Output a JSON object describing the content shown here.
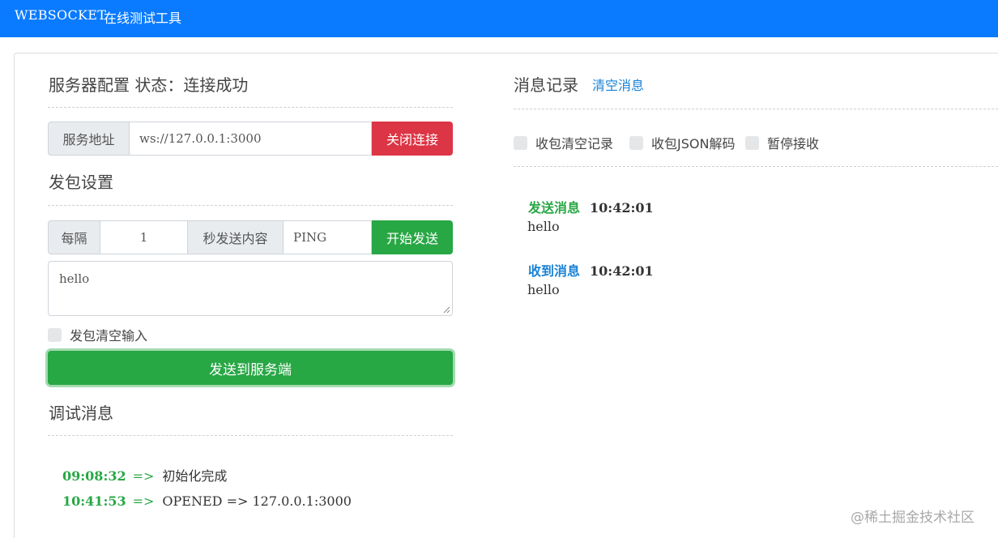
{
  "app": {
    "brand": "WEBSOCKET",
    "subtitle": "在线测试工具"
  },
  "server": {
    "title": "服务器配置 状态：连接成功",
    "address_label": "服务地址",
    "address_value": "ws://127.0.0.1:3000",
    "close_button": "关闭连接"
  },
  "packet": {
    "title": "发包设置",
    "interval_label": "每隔",
    "interval_value": "1",
    "content_label": "秒发送内容",
    "content_value": "PING",
    "start_button": "开始发送",
    "message_text": "hello",
    "clear_input_label": "发包清空输入",
    "send_button": "发送到服务端"
  },
  "debug": {
    "title": "调试消息",
    "entries": [
      {
        "time": "09:08:32",
        "arrow": "=>",
        "text": "初始化完成"
      },
      {
        "time": "10:41:53",
        "arrow": "=>",
        "text": "OPENED => 127.0.0.1:3000"
      }
    ]
  },
  "messages": {
    "title": "消息记录",
    "clear_link": "清空消息",
    "options": [
      "收包清空记录",
      "收包JSON解码",
      "暂停接收"
    ],
    "items": [
      {
        "label": "发送消息",
        "label_color": "#28a745",
        "time": "10:42:01",
        "body": "hello"
      },
      {
        "label": "收到消息",
        "label_color": "#1a82d6",
        "time": "10:42:01",
        "body": "hello"
      }
    ]
  },
  "watermark": "@稀土掘金技术社区",
  "colors": {
    "topbar": "#0a7bff",
    "success": "#28a745",
    "danger": "#dc3545",
    "link": "#1a82d6"
  }
}
